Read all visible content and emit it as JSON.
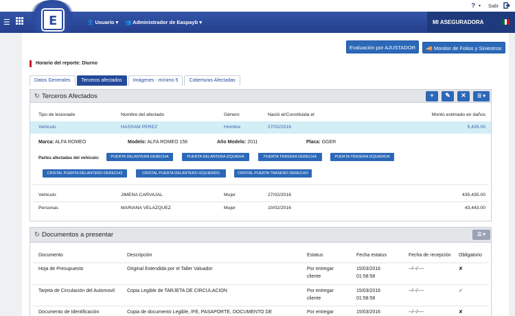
{
  "topbar": {
    "help_icon": "?",
    "salir_label": "Salir",
    "logout_icon": "logout-icon"
  },
  "navbar": {
    "menu_icon": "☰",
    "apps_icon": "▦",
    "logo_letter": "E",
    "usuario_label": "Usuario",
    "admin_label": "Administrador de Easpayb",
    "company": "MI ASEGURADORA",
    "flag_colors": [
      "#006847",
      "#ffffff",
      "#ce1126"
    ]
  },
  "actions": {
    "evaluacion_label": "Evaluación por AJUSTADOR",
    "monitor_label": "Monitor de Folios y Siniestros"
  },
  "horario": "Horario del reporte: Diurno",
  "tabs": [
    {
      "label": "Datos Generales",
      "active": false
    },
    {
      "label": "Terceros afectados",
      "active": true
    },
    {
      "label": "Imágenes - mínimo 5",
      "active": false
    },
    {
      "label": "Coberturas Afectadas",
      "active": false
    }
  ],
  "terceros": {
    "title": "Terceros Afectados",
    "buttons": {
      "add": "+",
      "edit": "✎",
      "delete": "✕",
      "menu": "☰ ▾"
    },
    "headers": {
      "tipo": "Tipo de lesionado",
      "nombre": "Nombre del afectado",
      "genero": "Género",
      "nacio": "Nació el/Constituida el",
      "monto": "Monto estimado en daños"
    },
    "rows": [
      {
        "tipo": "Vehiculo",
        "nombre": "HASSAM PEREZ",
        "genero": "Hombre",
        "fecha": "27/02/2016",
        "monto": "5,435.00"
      },
      {
        "tipo": "Vehiculo",
        "nombre": "JIMENA CARVAJAL",
        "genero": "Mujer",
        "fecha": "27/02/2016",
        "monto": "435,435.00"
      },
      {
        "tipo": "Personas",
        "nombre": "MARIANA VELAZQUEZ",
        "genero": "Mujer",
        "fecha": "10/02/2016",
        "monto": "43,443.00"
      }
    ],
    "detail": {
      "marca_label": "Marca:",
      "marca": "ALFA ROMEO",
      "modelo_label": "Modelo:",
      "modelo": "ALFA ROMEO 156",
      "anio_label": "Año Modelo:",
      "anio": "2011",
      "placa_label": "Placa:",
      "placa": "GGER",
      "partes_label": "Partes afectadas del vehículo:",
      "partes": [
        "PUERTA DELANTERA DERECHA",
        "PUERTA DELANTERA IZQUIERA",
        "PUERTA TRASERA DERECHA",
        "PUERTA TRASERA IZQUIERDA",
        "CRISTAL PUERTA DELANTERO DERECHO",
        "CRISTAL PUERTA DELANTERO IZQUIERDO",
        "CRISTAL PUERTA TRASERO DERECHO"
      ]
    }
  },
  "documentos": {
    "title": "Documentos a presentar",
    "menu": "☰ ▾",
    "headers": {
      "documento": "Documento",
      "descripcion": "Descripción",
      "estatus": "Estatus",
      "fecha": "Fecha estatus",
      "recepcion": "Fecha de recepción",
      "obligatorio": "Obligatorio"
    },
    "rows": [
      {
        "documento": "Hoja de Presupuesto",
        "descripcion": "Original Extendida por el Taller Valuador",
        "estatus1": "Por entregar",
        "estatus2": "cliente",
        "fecha1": "15/03/2016",
        "fecha2": "01:58:58",
        "recepcion": "--/--/----",
        "obligatorio": "✘"
      },
      {
        "documento": "Tarjeta de Circulación del Automovil",
        "descripcion": "Copia Legible de TARJETA DE CIRCULACION",
        "estatus1": "Por entregar",
        "estatus2": "cliente",
        "fecha1": "15/03/2016",
        "fecha2": "01:58:58",
        "recepcion": "--/--/----",
        "obligatorio": "✓"
      },
      {
        "documento": "Documento de Identificación",
        "descripcion": "Copia de documento Legible, IFE, PASAPORTE, DOCUMENTO DE",
        "estatus1": "Por entregar",
        "estatus2": "",
        "fecha1": "15/03/2016",
        "fecha2": "",
        "recepcion": "--/--/----",
        "obligatorio": "✘"
      }
    ]
  }
}
